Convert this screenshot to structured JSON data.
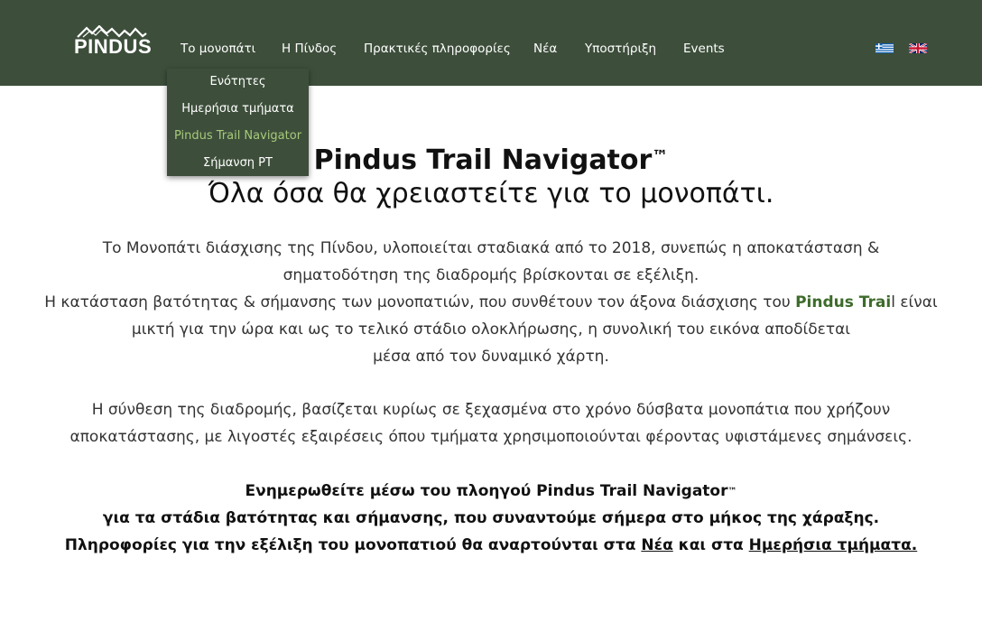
{
  "header": {
    "logo_text": "PINDUS",
    "nav": [
      {
        "label": "Το μονοπάτι"
      },
      {
        "label": "Η Πίνδος"
      },
      {
        "label": "Πρακτικές πληροφορίες"
      },
      {
        "label": "Νέα"
      },
      {
        "label": "Υποστήριξη"
      },
      {
        "label": "Events"
      }
    ],
    "languages": [
      "greek-flag-icon",
      "english-flag-icon"
    ]
  },
  "dropdown": {
    "items": [
      {
        "label": "Ενότητες"
      },
      {
        "label": "Ημερήσια τμήματα"
      },
      {
        "label": "Pindus Trail Navigator",
        "active": true
      },
      {
        "label": "Σήμανση PT"
      }
    ]
  },
  "main": {
    "title": "Pindus Trail Navigator",
    "title_mark": "™",
    "subtitle": "Όλα όσα θα χρειαστείτε για το μονοπάτι.",
    "p1_line1": "Το Μονοπάτι διάσχισης της Πίνδου, υλοποιείται σταδιακά από το 2018, συνεπώς η αποκατάσταση &",
    "p1_line2": "σηματοδότηση της διαδρομής βρίσκονται σε εξέλιξη.",
    "p2_line1_a": "Η κατάσταση βατότητας & σήμανσης των μονοπατιών, που συνθέτουν τον άξονα διάσχισης του ",
    "p2_line1_hl": "Pindus Trai",
    "p2_line1_b": "l είναι",
    "p2_line2": "μικτή για την ώρα και ως το τελικό στάδιο ολοκλήρωσης, η συνολική του εικόνα αποδίδεται",
    "p2_line3": "μέσα από τον δυναμικό χάρτη.",
    "p3_line1": "Η σύνθεση της διαδρομής, βασίζεται κυρίως σε ξεχασμένα στο χρόνο δύσβατα μονοπάτια που χρήζουν",
    "p3_line2": "αποκατάστασης, με λιγοστές εξαιρέσεις όπου τμήματα χρησιμοποιούνται φέροντας υφιστάμενες σημάνσεις.",
    "b1": "Ενημερωθείτε μέσω του πλοηγού Pindus Trail Navigator",
    "b1_mark": "™",
    "b2": "για τα στάδια βατότητας και σήμανσης, που συναντούμε σήμερα στο μήκος της χάραξης.",
    "b3_a": "Πληροφορίες για την εξέλιξη του μονοπατιού θα αναρτούνται στα ",
    "b3_link1": "Νέα",
    "b3_mid": " και στα ",
    "b3_link2": "Ημερήσια τμήματα."
  }
}
